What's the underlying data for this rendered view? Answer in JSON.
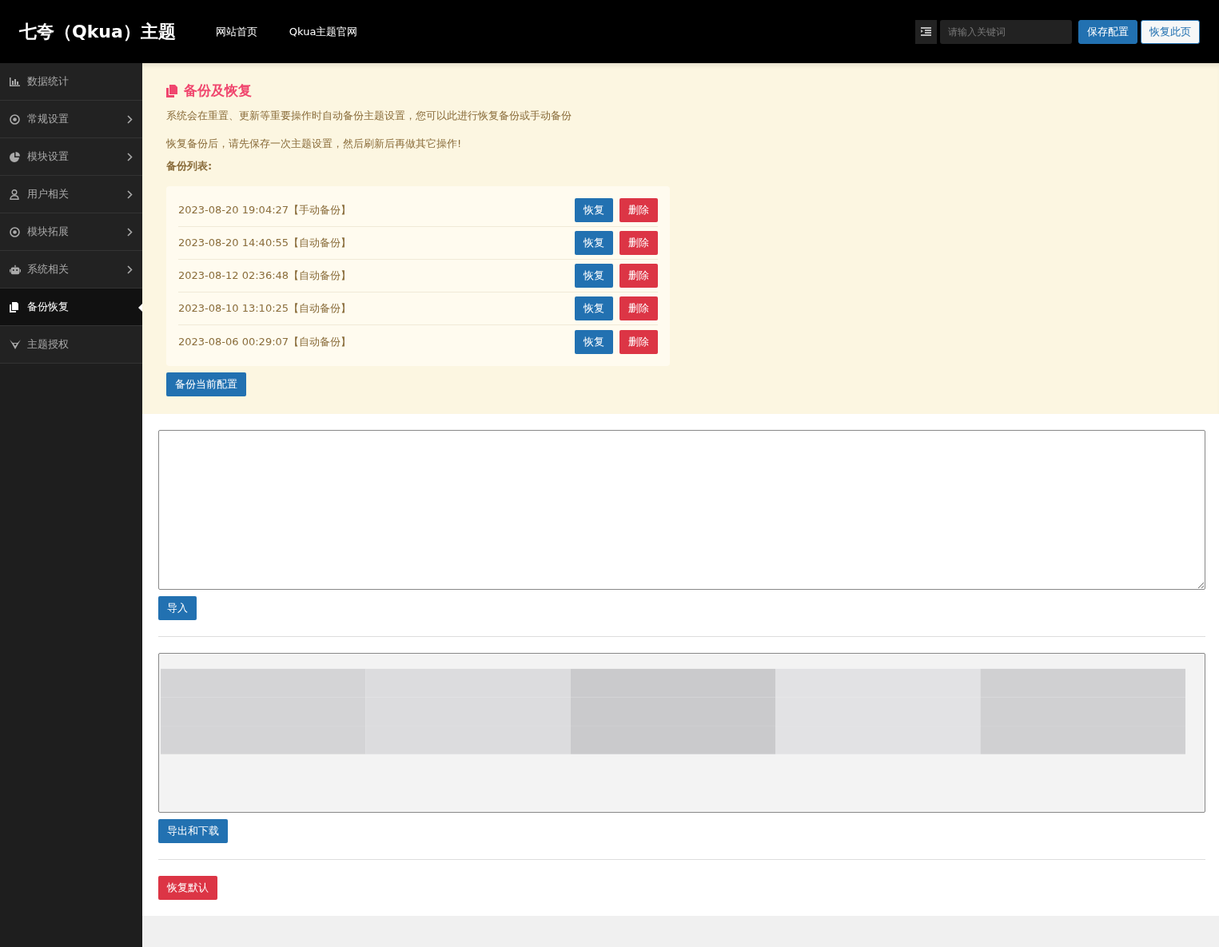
{
  "header": {
    "logo": "七夸（Qkua）主题",
    "nav": [
      "网站首页",
      "Qkua主题官网"
    ],
    "search": {
      "placeholder": "请输入关键词"
    },
    "buttons": [
      {
        "label": "保存配置",
        "kind": "primary"
      },
      {
        "label": "恢复此页",
        "kind": "outline"
      }
    ]
  },
  "sidebar": {
    "items": [
      {
        "label": "数据统计",
        "has_submenu": false,
        "selected": false
      },
      {
        "label": "常规设置",
        "has_submenu": true,
        "selected": false
      },
      {
        "label": "模块设置",
        "has_submenu": true,
        "selected": false
      },
      {
        "label": "用户相关",
        "has_submenu": true,
        "selected": false
      },
      {
        "label": "模块拓展",
        "has_submenu": true,
        "selected": false
      },
      {
        "label": "系统相关",
        "has_submenu": true,
        "selected": false
      },
      {
        "label": "备份恢复",
        "has_submenu": false,
        "selected": true
      },
      {
        "label": "主题授权",
        "has_submenu": false,
        "selected": false
      }
    ]
  },
  "backup": {
    "title": "备份及恢复",
    "notes": [
      "系统会在重置、更新等重要操作时自动备份主题设置，您可以此进行恢复备份或手动备份",
      "恢复备份后，请先保存一次主题设置，然后刷新后再做其它操作!"
    ],
    "list_label": "备份列表:",
    "entries": [
      {
        "time": "2023-08-20 19:04:27",
        "type": "【手动备份】",
        "restore": "恢复",
        "delete": "删除"
      },
      {
        "time": "2023-08-20 14:40:55",
        "type": "【自动备份】",
        "restore": "恢复",
        "delete": "删除"
      },
      {
        "time": "2023-08-12 02:36:48",
        "type": "【自动备份】",
        "restore": "恢复",
        "delete": "删除"
      },
      {
        "time": "2023-08-10 13:10:25",
        "type": "【自动备份】",
        "restore": "恢复",
        "delete": "删除"
      },
      {
        "time": "2023-08-06 00:29:07",
        "type": "【自动备份】",
        "restore": "恢复",
        "delete": "删除"
      }
    ],
    "backup_button": "备份当前配置"
  },
  "import": {
    "button": "导入"
  },
  "export": {
    "button": "导出和下载"
  },
  "reset": {
    "button": "恢复默认"
  }
}
